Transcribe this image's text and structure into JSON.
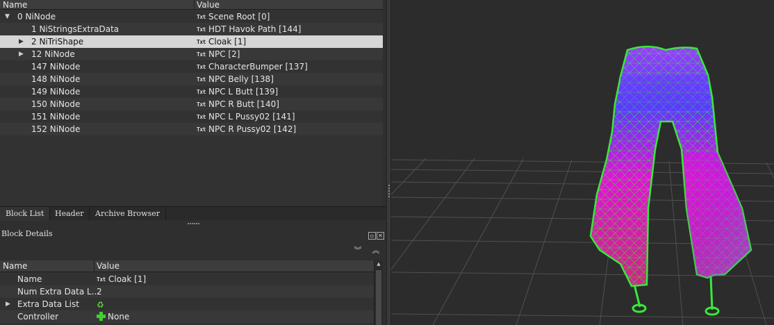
{
  "block_list": {
    "headers": {
      "name": "Name",
      "value": "Value"
    },
    "rows": [
      {
        "name": "0 NiNode",
        "value": "Scene Root [0]",
        "indent": 0,
        "arrow": "down"
      },
      {
        "name": "1 NiStringsExtraData",
        "value": "HDT Havok Path [144]",
        "indent": 1,
        "arrow": ""
      },
      {
        "name": "2 NiTriShape",
        "value": "Cloak [1]",
        "indent": 1,
        "arrow": "right",
        "selected": true
      },
      {
        "name": "12 NiNode",
        "value": "NPC [2]",
        "indent": 1,
        "arrow": "right"
      },
      {
        "name": "147 NiNode",
        "value": "CharacterBumper [137]",
        "indent": 1,
        "arrow": ""
      },
      {
        "name": "148 NiNode",
        "value": "NPC Belly [138]",
        "indent": 1,
        "arrow": ""
      },
      {
        "name": "149 NiNode",
        "value": "NPC L Butt [139]",
        "indent": 1,
        "arrow": ""
      },
      {
        "name": "150 NiNode",
        "value": "NPC R Butt [140]",
        "indent": 1,
        "arrow": ""
      },
      {
        "name": "151 NiNode",
        "value": "NPC L Pussy02 [141]",
        "indent": 1,
        "arrow": ""
      },
      {
        "name": "152 NiNode",
        "value": "NPC R Pussy02 [142]",
        "indent": 1,
        "arrow": ""
      }
    ]
  },
  "tabs": [
    {
      "label": "Block List",
      "active": true
    },
    {
      "label": "Header",
      "active": false
    },
    {
      "label": "Archive Browser",
      "active": false
    }
  ],
  "block_details": {
    "title": "Block Details",
    "headers": {
      "name": "Name",
      "value": "Value"
    },
    "rows": [
      {
        "name": "Name",
        "value": "Cloak [1]",
        "icon": "txt-icon"
      },
      {
        "name": "Num Extra Data L...",
        "value": "2",
        "icon": ""
      },
      {
        "name": "Extra Data List",
        "value": "",
        "icon": "recycle-icon",
        "arrow": true
      },
      {
        "name": "Controller",
        "value": "None",
        "icon": "green-plus-icon"
      }
    ]
  },
  "icons": {
    "txt_label": "Txt"
  },
  "colors": {
    "mesh_wire": "#39e83a",
    "mesh_fill_a": "#e011d8",
    "mesh_fill_b": "#6a2cff",
    "selection": "#d6d6d6"
  }
}
